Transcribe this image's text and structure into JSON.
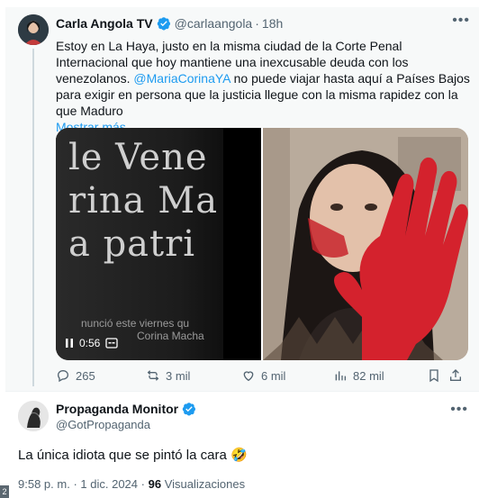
{
  "quoted_tweet": {
    "author_name": "Carla Angola TV",
    "author_handle": "@carlaangola",
    "time_sep": "·",
    "time": "18h",
    "more_label": "•••",
    "text_line1": "Estoy en La Haya, justo en la misma ciudad de la Corte Penal Internacional que hoy mantiene una inexcusable deuda con los venezolanos.",
    "mention": "@MariaCorinaYA",
    "text_line2": " no puede viajar hasta aquí a Países Bajos para exigir en persona que la justicia llegue con la misma rapidez con la que Maduro",
    "show_more": "Mostrar más",
    "video": {
      "overlay_line1": "le Vene",
      "overlay_line2": "rina Ma",
      "overlay_line3": "a patri",
      "overlay_small": "nunció este viernes qu",
      "overlay_small2": "Corina Macha",
      "duration": "0:56"
    },
    "actions": {
      "replies": "265",
      "reposts": "3 mil",
      "likes": "6 mil",
      "views": "82 mil"
    }
  },
  "reply_tweet": {
    "author_name": "Propaganda Monitor",
    "author_handle": "@GotPropaganda",
    "more_label": "•••",
    "text": "La única idiota que se pintó la cara 🤣",
    "time": "9:58 p. m.",
    "date_sep": "·",
    "date": "1 dic. 2024",
    "date_sep2": "·",
    "views_count": "96",
    "views_label": "Visualizaciones"
  },
  "corner_badge": "2",
  "colors": {
    "accent": "#1d9bf0",
    "text": "#0f1419",
    "muted": "#536471",
    "quoted_bg": "#f7f9f9"
  }
}
